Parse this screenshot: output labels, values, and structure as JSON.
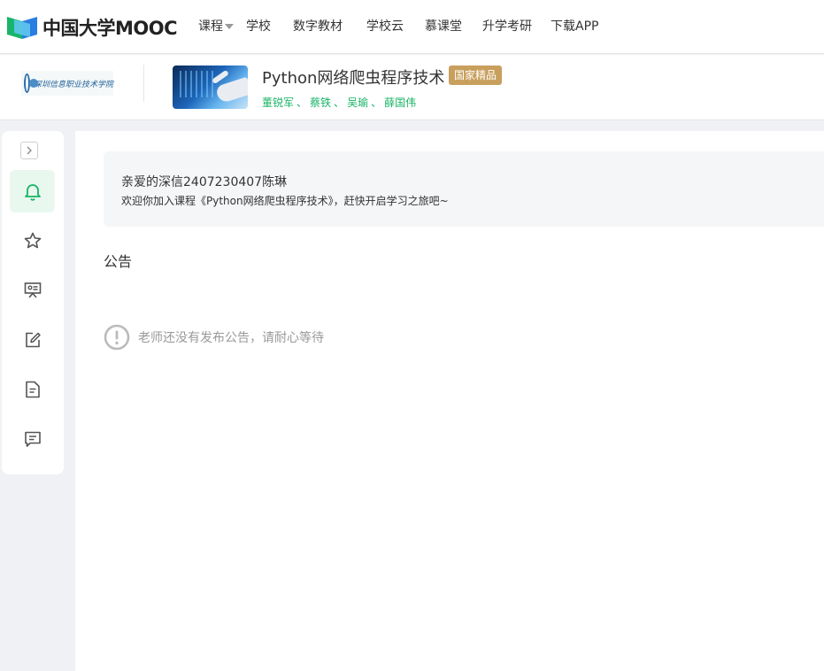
{
  "topnav": {
    "logo_text": "中国大学MOOC",
    "items": [
      {
        "label": "课程",
        "has_caret": true
      },
      {
        "label": "学校"
      },
      {
        "label": "数字教材"
      },
      {
        "label": "学校云"
      },
      {
        "label": "慕课堂"
      },
      {
        "label": "升学考研"
      },
      {
        "label": "下载APP"
      }
    ]
  },
  "course": {
    "school_logo_text": "深圳信息职业技术学院",
    "title": "Python网络爬虫程序技术",
    "badge": "国家精品",
    "teachers": [
      "董锐军",
      "蔡铁",
      "吴瑜",
      "薛国伟"
    ],
    "teacher_separator": "、"
  },
  "sidebar": {
    "items": [
      {
        "icon": "bell-icon",
        "active": true
      },
      {
        "icon": "star-icon",
        "active": false
      },
      {
        "icon": "presentation-icon",
        "active": false
      },
      {
        "icon": "edit-icon",
        "active": false
      },
      {
        "icon": "document-icon",
        "active": false
      },
      {
        "icon": "message-icon",
        "active": false
      }
    ]
  },
  "main": {
    "welcome_name": "亲爱的深信2407230407陈琳",
    "welcome_message": "欢迎你加入课程《Python网络爬虫程序技术》，赶快开启学习之旅吧~",
    "section_title": "公告",
    "empty_text": "老师还没有发布公告，请耐心等待"
  },
  "colors": {
    "brand_green": "#18b466",
    "brand_blue": "#2a7de1",
    "badge_gold": "#c89f5d"
  }
}
